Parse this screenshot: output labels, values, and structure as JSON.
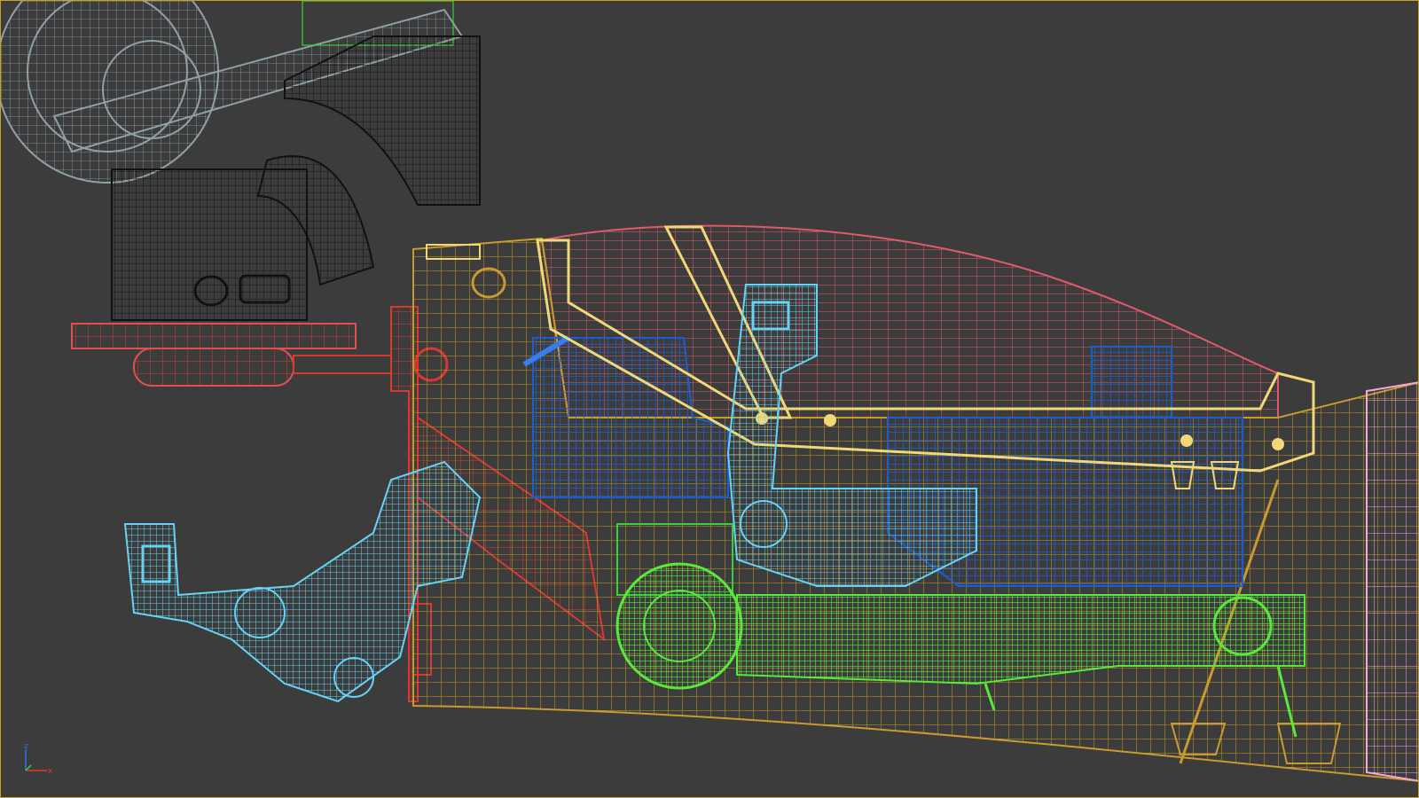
{
  "viewport": {
    "background_color": "#3c3c3c",
    "border_color": "#c9a224"
  },
  "gizmo": {
    "z_label": "z",
    "x_label": "x",
    "colors": {
      "z": "#3a6cf0",
      "x": "#e03a2a",
      "y": "#3ad03a"
    }
  },
  "objects": [
    {
      "name": "gray-arm-assembly",
      "color": "#8fa0a8"
    },
    {
      "name": "black-duct-body",
      "color": "#1a1a1a"
    },
    {
      "name": "red-frame",
      "color": "#d83a30"
    },
    {
      "name": "pink-canopy",
      "color": "#e05a6a"
    },
    {
      "name": "yellow-hull",
      "color": "#c99a2e"
    },
    {
      "name": "light-yellow-frame",
      "color": "#f0d878"
    },
    {
      "name": "blue-interior",
      "color": "#1f5ec8"
    },
    {
      "name": "cyan-robot-arm",
      "color": "#66d3f5"
    },
    {
      "name": "green-drivetrain",
      "color": "#5ae83a"
    },
    {
      "name": "pink-panel",
      "color": "#f2a8d8"
    }
  ]
}
